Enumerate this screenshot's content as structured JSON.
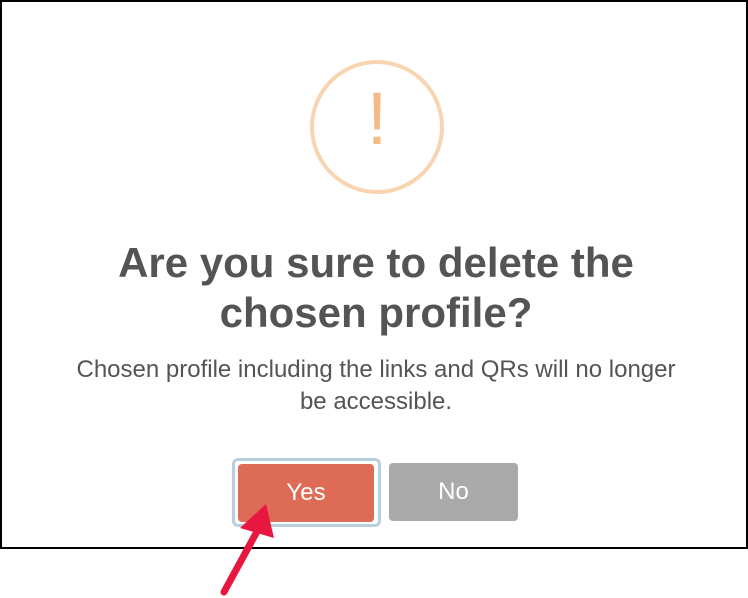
{
  "dialog": {
    "icon": "exclamation-icon",
    "icon_glyph": "!",
    "title_line1": "Are you sure to delete the",
    "title_line2": "chosen profile?",
    "message_line1": "Chosen profile including the links and QRs will no longer",
    "message_line2": "be accessible.",
    "confirm_label": "Yes",
    "cancel_label": "No"
  },
  "colors": {
    "confirm_button": "#dd6b55",
    "cancel_button": "#aaaaaa",
    "icon_ring": "#f8d4b0",
    "icon_glyph": "#f5b986",
    "text": "#545454",
    "annotation_arrow": "#e8173f"
  },
  "annotation": {
    "icon": "arrow-pointer-icon"
  }
}
